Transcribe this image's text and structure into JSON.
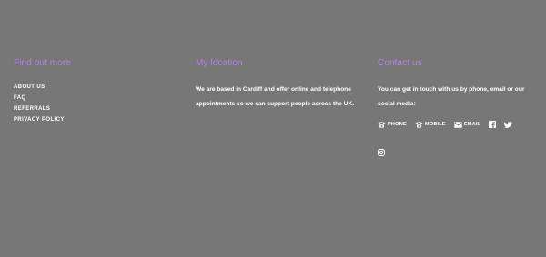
{
  "colors": {
    "background": "#777777",
    "heading": "#b084dc",
    "text": "#ffffff"
  },
  "find_out_more": {
    "heading": "Find out more",
    "links": [
      "ABOUT US",
      "FAQ",
      "REFERRALS",
      "PRIVACY POLICY"
    ]
  },
  "location": {
    "heading": "My location",
    "text": "We are based in Cardiff and offer online and telephone appointments so we can support people across the UK."
  },
  "contact": {
    "heading": "Contact us",
    "text": "You can get in touch with us by phone, email or our social media:",
    "phone_label": "PHONE",
    "mobile_label": "MOBILE",
    "email_label": "EMAIL",
    "icons": [
      "phone-icon",
      "mobile-icon",
      "email-icon",
      "facebook-icon",
      "twitter-icon",
      "instagram-icon"
    ]
  }
}
